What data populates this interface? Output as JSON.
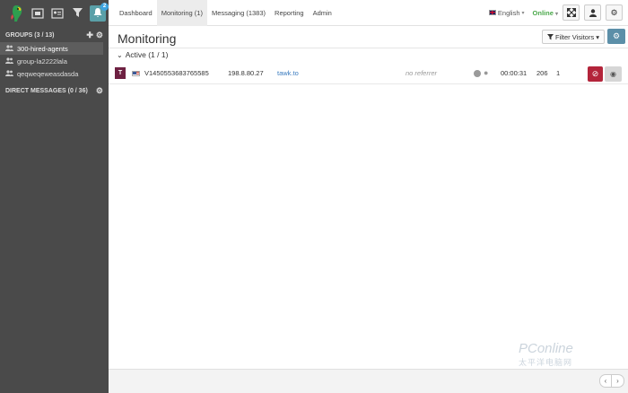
{
  "sidebar": {
    "notification_count": "2",
    "groups_header": "GROUPS (3 / 13)",
    "groups": [
      {
        "label": "300-hired-agents",
        "active": true
      },
      {
        "label": "group-la2222lala",
        "active": false
      },
      {
        "label": "qeqweqeweasdasda",
        "active": false
      }
    ],
    "direct_header": "DIRECT MESSAGES (0 / 36)"
  },
  "nav": {
    "tabs": [
      "Dashboard",
      "Monitoring (1)",
      "Messaging (1383)",
      "Reporting",
      "Admin"
    ],
    "active_tab": 1,
    "language": "English",
    "status": "Online"
  },
  "main": {
    "title": "Monitoring",
    "filter_label": "Filter Visitors",
    "active_header": "Active (1 / 1)",
    "visitors": [
      {
        "badge": "T",
        "visitor_id": "V1450553683765585",
        "ip": "198.8.80.27",
        "page": "tawk.to",
        "referrer": "no referrer",
        "duration": "00:00:31",
        "views": "206",
        "chats": "1"
      }
    ]
  },
  "watermark": {
    "line1": "PConline",
    "line2": "太平洋电脑网"
  },
  "colors": {
    "sidebar": "#4a4a4a",
    "online": "#4aa84a",
    "ban": "#b3243a",
    "settings": "#5c8fa8",
    "badge": "#6e2142"
  }
}
